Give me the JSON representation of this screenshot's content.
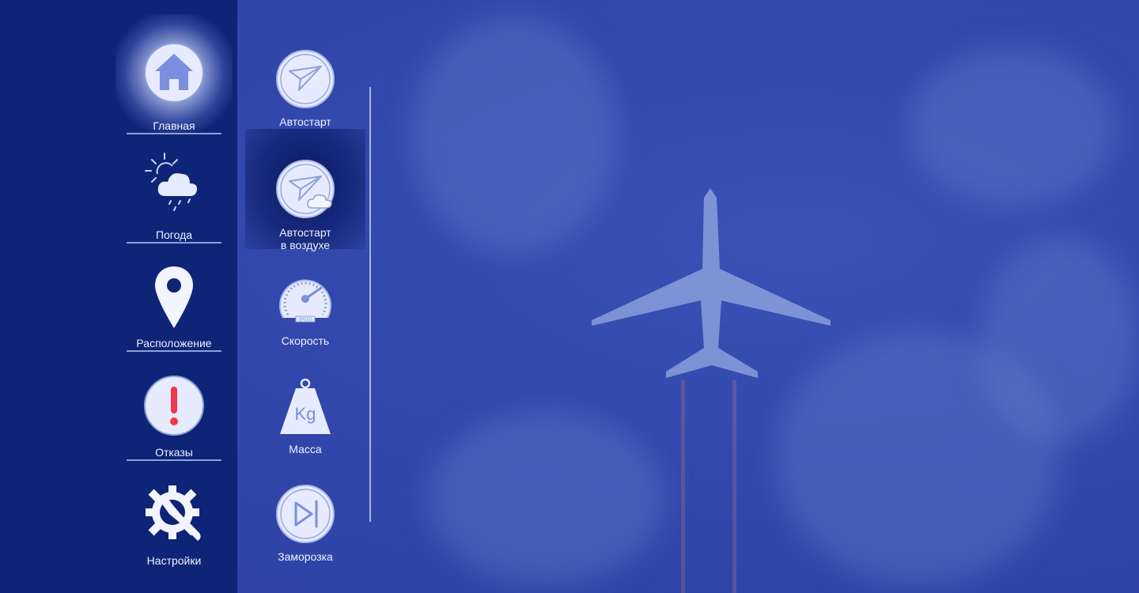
{
  "nav": {
    "items": [
      {
        "label": "Главная",
        "icon": "home-icon"
      },
      {
        "label": "Погода",
        "icon": "weather-icon"
      },
      {
        "label": "Расположение",
        "icon": "location-pin-icon"
      },
      {
        "label": "Отказы",
        "icon": "alert-icon"
      },
      {
        "label": "Настройки",
        "icon": "settings-icon"
      }
    ]
  },
  "submenu": {
    "items": [
      {
        "label": "Автостарт",
        "icon": "autostart-icon"
      },
      {
        "label_line1": "Автостарт",
        "label_line2": "в воздухе",
        "icon": "autostart-air-icon"
      },
      {
        "label": "Скорость",
        "icon": "speedometer-icon",
        "gauge_text": "SPEED"
      },
      {
        "label": "Масса",
        "icon": "weight-icon",
        "weight_text": "Kg"
      },
      {
        "label": "Заморозка",
        "icon": "freeze-icon"
      }
    ]
  },
  "colors": {
    "sidebar": "#0e2476",
    "background": "#2f44a6",
    "icon_fill": "#e6ebff",
    "icon_accent": "#7b8fe0",
    "alert": "#f0384b"
  }
}
